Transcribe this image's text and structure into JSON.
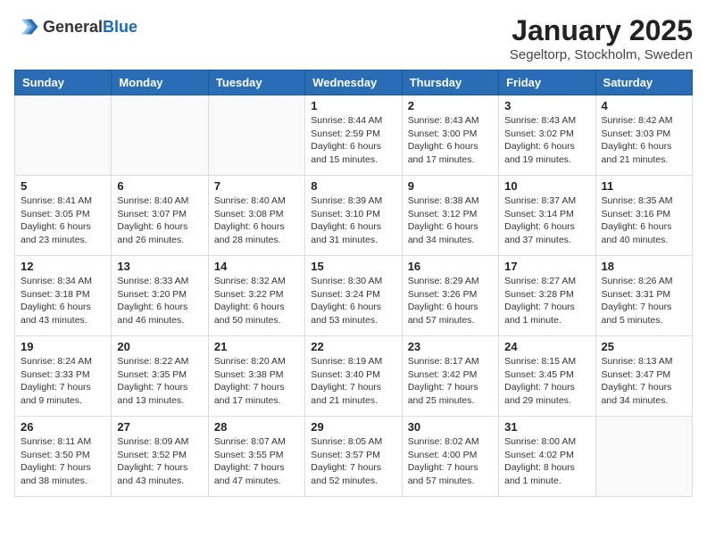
{
  "header": {
    "logo_general": "General",
    "logo_blue": "Blue",
    "title": "January 2025",
    "subtitle": "Segeltorp, Stockholm, Sweden"
  },
  "weekdays": [
    "Sunday",
    "Monday",
    "Tuesday",
    "Wednesday",
    "Thursday",
    "Friday",
    "Saturday"
  ],
  "weeks": [
    [
      {
        "day": "",
        "info": ""
      },
      {
        "day": "",
        "info": ""
      },
      {
        "day": "",
        "info": ""
      },
      {
        "day": "1",
        "info": "Sunrise: 8:44 AM\nSunset: 2:59 PM\nDaylight: 6 hours\nand 15 minutes."
      },
      {
        "day": "2",
        "info": "Sunrise: 8:43 AM\nSunset: 3:00 PM\nDaylight: 6 hours\nand 17 minutes."
      },
      {
        "day": "3",
        "info": "Sunrise: 8:43 AM\nSunset: 3:02 PM\nDaylight: 6 hours\nand 19 minutes."
      },
      {
        "day": "4",
        "info": "Sunrise: 8:42 AM\nSunset: 3:03 PM\nDaylight: 6 hours\nand 21 minutes."
      }
    ],
    [
      {
        "day": "5",
        "info": "Sunrise: 8:41 AM\nSunset: 3:05 PM\nDaylight: 6 hours\nand 23 minutes."
      },
      {
        "day": "6",
        "info": "Sunrise: 8:40 AM\nSunset: 3:07 PM\nDaylight: 6 hours\nand 26 minutes."
      },
      {
        "day": "7",
        "info": "Sunrise: 8:40 AM\nSunset: 3:08 PM\nDaylight: 6 hours\nand 28 minutes."
      },
      {
        "day": "8",
        "info": "Sunrise: 8:39 AM\nSunset: 3:10 PM\nDaylight: 6 hours\nand 31 minutes."
      },
      {
        "day": "9",
        "info": "Sunrise: 8:38 AM\nSunset: 3:12 PM\nDaylight: 6 hours\nand 34 minutes."
      },
      {
        "day": "10",
        "info": "Sunrise: 8:37 AM\nSunset: 3:14 PM\nDaylight: 6 hours\nand 37 minutes."
      },
      {
        "day": "11",
        "info": "Sunrise: 8:35 AM\nSunset: 3:16 PM\nDaylight: 6 hours\nand 40 minutes."
      }
    ],
    [
      {
        "day": "12",
        "info": "Sunrise: 8:34 AM\nSunset: 3:18 PM\nDaylight: 6 hours\nand 43 minutes."
      },
      {
        "day": "13",
        "info": "Sunrise: 8:33 AM\nSunset: 3:20 PM\nDaylight: 6 hours\nand 46 minutes."
      },
      {
        "day": "14",
        "info": "Sunrise: 8:32 AM\nSunset: 3:22 PM\nDaylight: 6 hours\nand 50 minutes."
      },
      {
        "day": "15",
        "info": "Sunrise: 8:30 AM\nSunset: 3:24 PM\nDaylight: 6 hours\nand 53 minutes."
      },
      {
        "day": "16",
        "info": "Sunrise: 8:29 AM\nSunset: 3:26 PM\nDaylight: 6 hours\nand 57 minutes."
      },
      {
        "day": "17",
        "info": "Sunrise: 8:27 AM\nSunset: 3:28 PM\nDaylight: 7 hours\nand 1 minute."
      },
      {
        "day": "18",
        "info": "Sunrise: 8:26 AM\nSunset: 3:31 PM\nDaylight: 7 hours\nand 5 minutes."
      }
    ],
    [
      {
        "day": "19",
        "info": "Sunrise: 8:24 AM\nSunset: 3:33 PM\nDaylight: 7 hours\nand 9 minutes."
      },
      {
        "day": "20",
        "info": "Sunrise: 8:22 AM\nSunset: 3:35 PM\nDaylight: 7 hours\nand 13 minutes."
      },
      {
        "day": "21",
        "info": "Sunrise: 8:20 AM\nSunset: 3:38 PM\nDaylight: 7 hours\nand 17 minutes."
      },
      {
        "day": "22",
        "info": "Sunrise: 8:19 AM\nSunset: 3:40 PM\nDaylight: 7 hours\nand 21 minutes."
      },
      {
        "day": "23",
        "info": "Sunrise: 8:17 AM\nSunset: 3:42 PM\nDaylight: 7 hours\nand 25 minutes."
      },
      {
        "day": "24",
        "info": "Sunrise: 8:15 AM\nSunset: 3:45 PM\nDaylight: 7 hours\nand 29 minutes."
      },
      {
        "day": "25",
        "info": "Sunrise: 8:13 AM\nSunset: 3:47 PM\nDaylight: 7 hours\nand 34 minutes."
      }
    ],
    [
      {
        "day": "26",
        "info": "Sunrise: 8:11 AM\nSunset: 3:50 PM\nDaylight: 7 hours\nand 38 minutes."
      },
      {
        "day": "27",
        "info": "Sunrise: 8:09 AM\nSunset: 3:52 PM\nDaylight: 7 hours\nand 43 minutes."
      },
      {
        "day": "28",
        "info": "Sunrise: 8:07 AM\nSunset: 3:55 PM\nDaylight: 7 hours\nand 47 minutes."
      },
      {
        "day": "29",
        "info": "Sunrise: 8:05 AM\nSunset: 3:57 PM\nDaylight: 7 hours\nand 52 minutes."
      },
      {
        "day": "30",
        "info": "Sunrise: 8:02 AM\nSunset: 4:00 PM\nDaylight: 7 hours\nand 57 minutes."
      },
      {
        "day": "31",
        "info": "Sunrise: 8:00 AM\nSunset: 4:02 PM\nDaylight: 8 hours\nand 1 minute."
      },
      {
        "day": "",
        "info": ""
      }
    ]
  ]
}
